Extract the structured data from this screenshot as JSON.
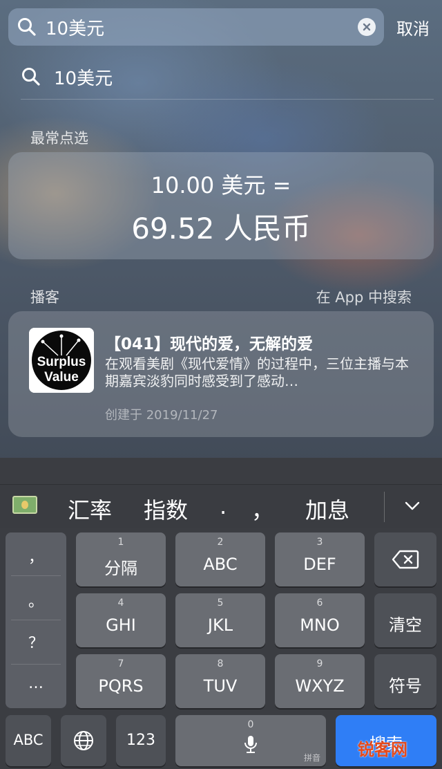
{
  "search": {
    "query": "10美元",
    "cancel_label": "取消"
  },
  "suggestion": {
    "text": "10美元"
  },
  "top_hits": {
    "section_title": "最常点选",
    "conversion_line1": "10.00 美元 =",
    "conversion_line2": "69.52 人民币"
  },
  "podcasts": {
    "section_title": "播客",
    "search_in_app_label": "在 App 中搜索",
    "artwork_text_1": "Surplus",
    "artwork_text_2": "Value",
    "episode_title": "【041】现代的爱，无解的爱",
    "episode_desc": "在观看美剧《现代爱情》的过程中，三位主播与本期嘉宾淡豹同时感受到了感动…",
    "episode_date": "创建于 2019/11/27"
  },
  "candidates": {
    "emoji_icon": "money-bill-icon",
    "items": [
      "汇率",
      "指数",
      ".",
      "，",
      "加息"
    ]
  },
  "keyboard": {
    "punctuation": [
      "，",
      "。",
      "？",
      "…"
    ],
    "keys": [
      {
        "num": "1",
        "label": "分隔"
      },
      {
        "num": "2",
        "label": "ABC"
      },
      {
        "num": "3",
        "label": "DEF"
      },
      {
        "num": "4",
        "label": "GHI"
      },
      {
        "num": "5",
        "label": "JKL"
      },
      {
        "num": "6",
        "label": "MNO"
      },
      {
        "num": "7",
        "label": "PQRS"
      },
      {
        "num": "8",
        "label": "TUV"
      },
      {
        "num": "9",
        "label": "WXYZ"
      }
    ],
    "clear_label": "清空",
    "symbol_label": "符号",
    "abc_label": "ABC",
    "num_label": "123",
    "space_num": "0",
    "space_hint": "拼音",
    "search_label": "搜索"
  },
  "watermark": "锐客网",
  "colors": {
    "accent_blue": "#2f7ef6"
  }
}
